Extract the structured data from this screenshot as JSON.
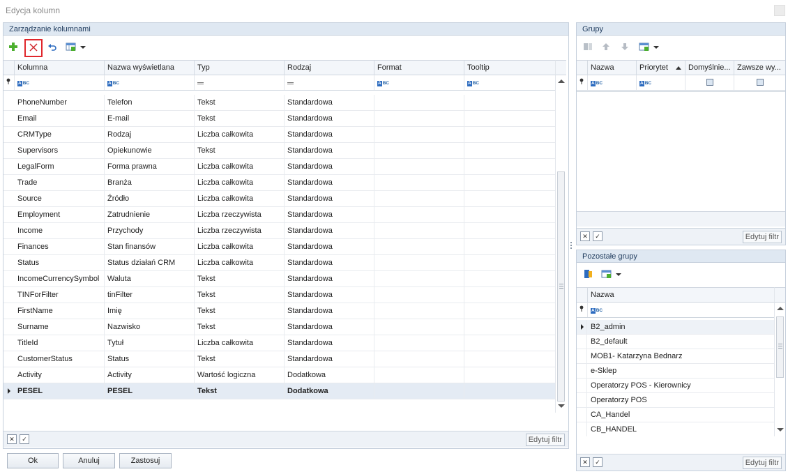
{
  "window": {
    "title": "Edycja kolumn"
  },
  "left_panel": {
    "title": "Zarządzanie kolumnami",
    "columns": [
      "Kolumna",
      "Nazwa wyświetlana",
      "Typ",
      "Rodzaj",
      "Format",
      "Tooltip"
    ],
    "rows": [
      {
        "kolumna": "PhoneNumber",
        "nazwa": "Telefon",
        "typ": "Tekst",
        "rodzaj": "Standardowa"
      },
      {
        "kolumna": "Email",
        "nazwa": "E-mail",
        "typ": "Tekst",
        "rodzaj": "Standardowa"
      },
      {
        "kolumna": "CRMType",
        "nazwa": "Rodzaj",
        "typ": "Liczba całkowita",
        "rodzaj": "Standardowa"
      },
      {
        "kolumna": "Supervisors",
        "nazwa": "Opiekunowie",
        "typ": "Tekst",
        "rodzaj": "Standardowa"
      },
      {
        "kolumna": "LegalForm",
        "nazwa": "Forma prawna",
        "typ": "Liczba całkowita",
        "rodzaj": "Standardowa"
      },
      {
        "kolumna": "Trade",
        "nazwa": "Branża",
        "typ": "Liczba całkowita",
        "rodzaj": "Standardowa"
      },
      {
        "kolumna": "Source",
        "nazwa": "Źródło",
        "typ": "Liczba całkowita",
        "rodzaj": "Standardowa"
      },
      {
        "kolumna": "Employment",
        "nazwa": "Zatrudnienie",
        "typ": "Liczba rzeczywista",
        "rodzaj": "Standardowa"
      },
      {
        "kolumna": "Income",
        "nazwa": "Przychody",
        "typ": "Liczba rzeczywista",
        "rodzaj": "Standardowa"
      },
      {
        "kolumna": "Finances",
        "nazwa": "Stan finansów",
        "typ": "Liczba całkowita",
        "rodzaj": "Standardowa"
      },
      {
        "kolumna": "Status",
        "nazwa": "Status działań CRM",
        "typ": "Liczba całkowita",
        "rodzaj": "Standardowa"
      },
      {
        "kolumna": "IncomeCurrencySymbol",
        "nazwa": "Waluta",
        "typ": "Tekst",
        "rodzaj": "Standardowa"
      },
      {
        "kolumna": "TINForFilter",
        "nazwa": "tinFilter",
        "typ": "Tekst",
        "rodzaj": "Standardowa"
      },
      {
        "kolumna": "FirstName",
        "nazwa": "Imię",
        "typ": "Tekst",
        "rodzaj": "Standardowa"
      },
      {
        "kolumna": "Surname",
        "nazwa": "Nazwisko",
        "typ": "Tekst",
        "rodzaj": "Standardowa"
      },
      {
        "kolumna": "TitleId",
        "nazwa": "Tytuł",
        "typ": "Liczba całkowita",
        "rodzaj": "Standardowa"
      },
      {
        "kolumna": "CustomerStatus",
        "nazwa": "Status",
        "typ": "Tekst",
        "rodzaj": "Standardowa"
      },
      {
        "kolumna": "Activity",
        "nazwa": "Activity",
        "typ": "Wartość logiczna",
        "rodzaj": "Dodatkowa"
      },
      {
        "kolumna": "PESEL",
        "nazwa": "PESEL",
        "typ": "Tekst",
        "rodzaj": "Dodatkowa",
        "selected": true
      }
    ],
    "edit_filter": "Edytuj filtr"
  },
  "groups_panel": {
    "title": "Grupy",
    "columns": [
      "Nazwa",
      "Priorytet",
      "Domyślnie...",
      "Zawsze wy..."
    ],
    "edit_filter": "Edytuj filtr"
  },
  "other_groups_panel": {
    "title": "Pozostałe grupy",
    "column": "Nazwa",
    "items": [
      "B2_admin",
      "B2_default",
      "MOB1- Katarzyna Bednarz",
      "e-Sklep",
      "Operatorzy POS - Kierownicy",
      "Operatorzy POS",
      "CA_Handel",
      "CB_HANDEL"
    ],
    "edit_filter": "Edytuj filtr"
  },
  "buttons": {
    "ok": "Ok",
    "cancel": "Anuluj",
    "apply": "Zastosuj"
  },
  "icons": {
    "add": "plus-icon",
    "delete": "delete-x-icon",
    "undo": "undo-icon",
    "views": "grid-view-icon"
  },
  "colors": {
    "accent_red": "#e0262c",
    "header_bg": "#dfe8f2",
    "selection": "#e4ebf4"
  }
}
